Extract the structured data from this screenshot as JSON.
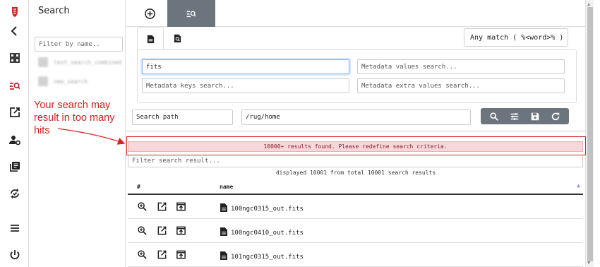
{
  "sidebar": {
    "icons": [
      "crest-logo-icon",
      "back-arrow-icon",
      "dashboard-grid-icon",
      "search-icon",
      "open-external-icon",
      "user-settings-icon",
      "library-books-icon",
      "sync-icon",
      "menu-icon",
      "power-icon"
    ],
    "active_color": "#c62828"
  },
  "search_panel": {
    "title": "Search",
    "filter_placeholder": "Filter by name..",
    "saved_searches": [
      "test_search_combined",
      "new_search"
    ]
  },
  "top_tabs": {
    "new_icon": "add-circle-icon",
    "search_icon": "manage-search-icon"
  },
  "criteria": {
    "tabs": [
      "file-icon",
      "metadata-search-icon"
    ],
    "match_mode": "Any match ( %<word>% )",
    "filename_value": "fits",
    "metadata_values_placeholder": "Metadata values search...",
    "metadata_keys_placeholder": "Metadata keys search...",
    "metadata_extra_placeholder": "Metadata extra values search...",
    "path_label": "Search path",
    "path_value": "/rug/home",
    "actions": [
      "search-icon",
      "tune-icon",
      "save-icon",
      "refresh-icon"
    ]
  },
  "results": {
    "alert": "10000+ results found. Please redefine search criteria.",
    "filter_placeholder": "Filter search result...",
    "summary": "displayed 10001 from total 10001 search results",
    "columns": [
      "#",
      "name"
    ],
    "rows": [
      {
        "name": "100ngc0315_out.fits"
      },
      {
        "name": "100ngc0410_out.fits"
      },
      {
        "name": "101ngc0315_out.fits"
      }
    ]
  },
  "annotation": {
    "text": "Your search may result in too many hits",
    "color": "#d32020"
  }
}
